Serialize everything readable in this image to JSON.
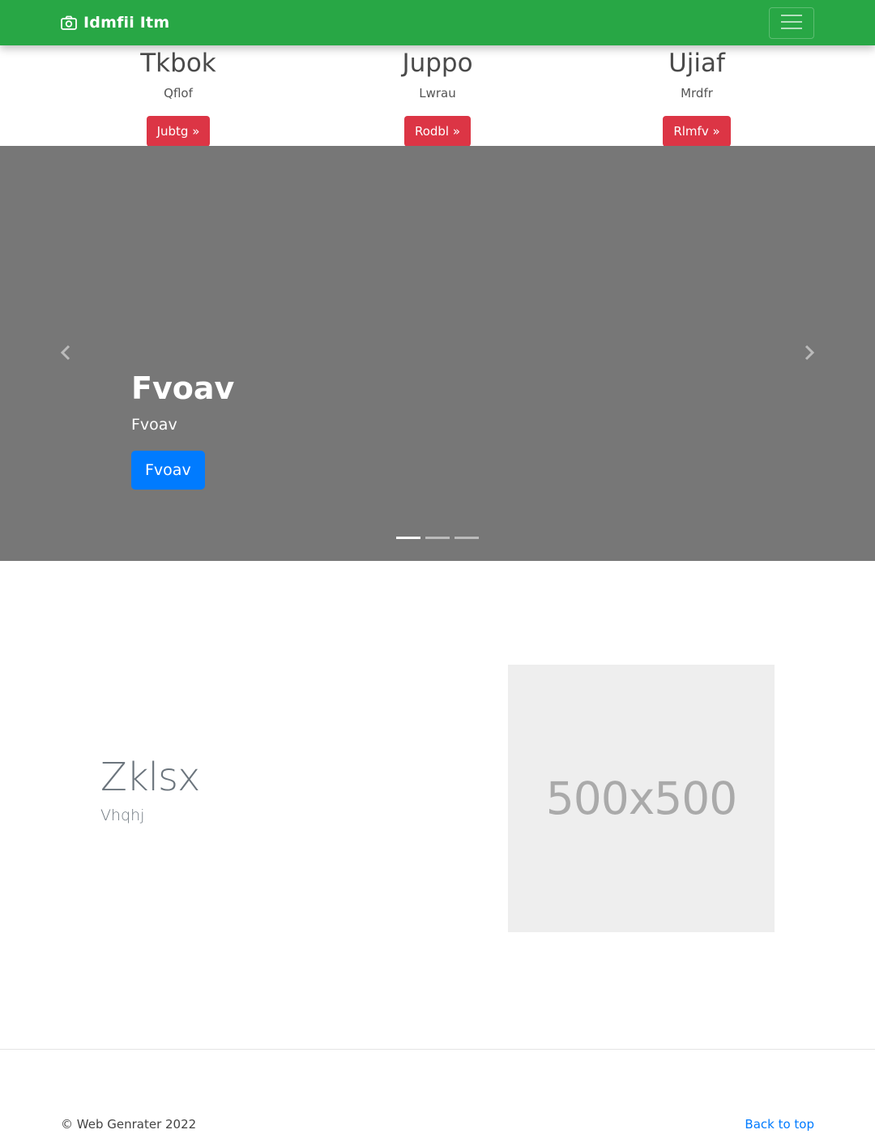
{
  "navbar": {
    "brand_icon": "camera-icon",
    "brand_text": "Idmfii Itm",
    "toggler_icon": "hamburger-icon",
    "background_color": "#28a745"
  },
  "features": [
    {
      "heading": "Tkbok",
      "text": "Qflof",
      "button": "Jubtg »"
    },
    {
      "heading": "Juppo",
      "text": "Lwrau",
      "button": "Rodbl »"
    },
    {
      "heading": "Ujiaf",
      "text": "Mrdfr",
      "button": "Rlmfv »"
    }
  ],
  "carousel": {
    "background_color": "#777777",
    "prev_icon": "chevron-left-icon",
    "next_icon": "chevron-right-icon",
    "caption": {
      "heading": "Fvoav",
      "text": "Fvoav",
      "button": "Fvoav"
    },
    "indicators": {
      "count": 3,
      "active_index": 0
    }
  },
  "featurette": {
    "heading": "Zklsx",
    "lead": "Vhqhj",
    "image_placeholder": "500x500"
  },
  "footer": {
    "copyright": "© Web Genrater 2022",
    "back_to_top": "Back to top"
  },
  "colors": {
    "red_button": "#dc3545",
    "blue_button": "#007bff",
    "link": "#007bff"
  }
}
